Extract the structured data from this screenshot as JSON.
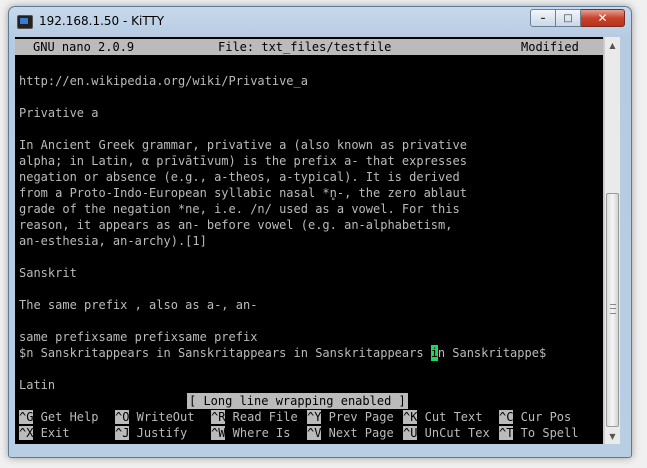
{
  "window": {
    "title": "192.168.1.50 - KiTTY",
    "controls": {
      "minimize": "–",
      "maximize": "□",
      "close": "✕"
    }
  },
  "nano": {
    "version": "GNU nano 2.0.9",
    "file": "File: txt_files/testfile",
    "state": "Modified",
    "lines": [
      "http://en.wikipedia.org/wiki/Privative_a",
      "",
      "Privative a",
      "",
      "In Ancient Greek grammar, privative a (also known as privative",
      "alpha; in Latin, α prīvātīvum) is the prefix a- that expresses",
      "negation or absence (e.g., a-theos, a-typical). It is derived",
      "from a Proto-Indo-European syllabic nasal *n̥-, the zero ablaut",
      "grade of the negation *ne, i.e. /n/ used as a vowel. For this",
      "reason, it appears as an- before vowel (e.g. an-alphabetism,",
      "an-esthesia, an-archy).[1]",
      "",
      "Sanskrit",
      "",
      "The same prefix , also as a-, an-",
      "",
      "same prefixsame prefixsame prefix",
      "$n Sanskritappears in Sanskritappears in Sanskritappears ",
      "",
      "Latin"
    ],
    "cursor_char": "i",
    "cursor_after": "n Sanskritappe$",
    "status_message": "[ Long line wrapping enabled ]",
    "shortcuts_row1": [
      {
        "key": "^G",
        "label": " Get Help"
      },
      {
        "key": "^O",
        "label": " WriteOut"
      },
      {
        "key": "^R",
        "label": " Read File"
      },
      {
        "key": "^Y",
        "label": " Prev Page"
      },
      {
        "key": "^K",
        "label": " Cut Text"
      },
      {
        "key": "^C",
        "label": " Cur Pos"
      }
    ],
    "shortcuts_row2": [
      {
        "key": "^X",
        "label": " Exit"
      },
      {
        "key": "^J",
        "label": " Justify"
      },
      {
        "key": "^W",
        "label": " Where Is"
      },
      {
        "key": "^V",
        "label": " Next Page"
      },
      {
        "key": "^U",
        "label": " UnCut Tex"
      },
      {
        "key": "^T",
        "label": " To Spell"
      }
    ]
  },
  "scrollbar": {
    "up_icon": "▲",
    "down_icon": "▼"
  }
}
